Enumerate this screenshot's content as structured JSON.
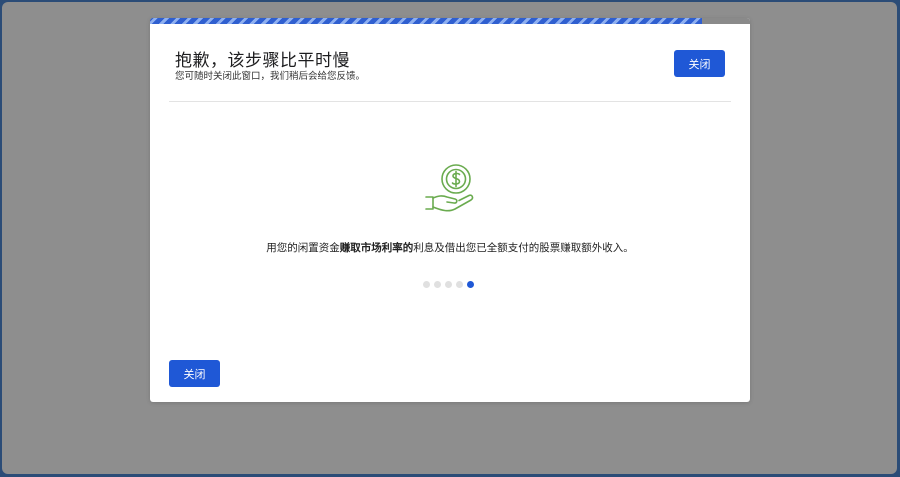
{
  "modal": {
    "title": "抱歉，该步骤比平时慢",
    "subtitle": "您可随时关闭此窗口，我们稍后会给您反馈。",
    "close_top_label": "关闭",
    "close_bottom_label": "关闭",
    "progress": 0.92,
    "message_before": "用您的闲置资金",
    "message_bold": "赚取市场利率的",
    "message_after": "利息及借出您已全额支付的股票赚取额外收入。",
    "illustration_icon": "hand-holding-coin-icon",
    "carousel": {
      "total": 5,
      "active_index": 4
    }
  },
  "colors": {
    "accent": "#1f58d6",
    "icon_green": "#6aab4f",
    "backdrop": "#8e8e8e"
  }
}
